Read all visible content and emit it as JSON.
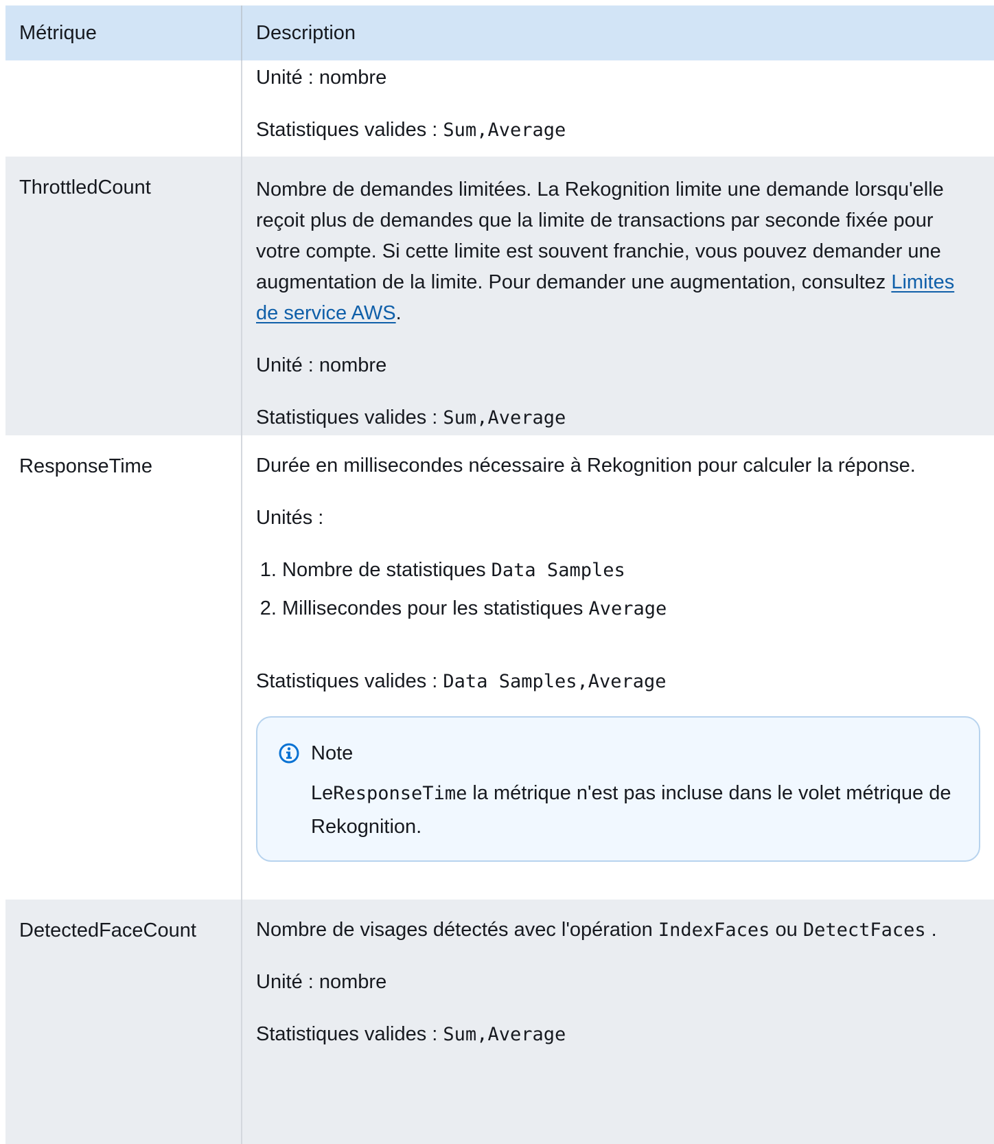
{
  "header": {
    "metric_col": "Métrique",
    "desc_col": "Description"
  },
  "rows": [
    {
      "metric": "",
      "unit": "Unité : nombre",
      "stats_label": "Statistiques valides : ",
      "stats_code": "Sum,Average"
    },
    {
      "metric": "ThrottledCount",
      "desc_text": "Nombre de demandes limitées. La Rekognition limite une demande lorsqu'elle reçoit plus de demandes que la limite de transactions par seconde fixée pour votre compte. Si cette limite est souvent franchie, vous pouvez demander une augmentation de la limite. Pour demander une augmentation, consultez ",
      "link_text": "Limites de service AWS",
      "after_link": ".",
      "unit": "Unité : nombre",
      "stats_label": "Statistiques valides : ",
      "stats_code": "Sum,Average"
    },
    {
      "metric": "ResponseTime",
      "desc_text": "Durée en millisecondes nécessaire à Rekognition pour calculer la réponse.",
      "units_label": "Unités :",
      "list": [
        {
          "text": "Nombre de statistiques ",
          "code": "Data Samples"
        },
        {
          "text": "Millisecondes pour les statistiques ",
          "code": "Average"
        }
      ],
      "stats_label": "Statistiques valides : ",
      "stats_code": "Data Samples,Average",
      "note": {
        "title": "Note",
        "prefix": "Le",
        "code": "ResponseTime",
        "text": " la métrique n'est pas incluse dans le volet métrique de Rekognition."
      }
    },
    {
      "metric": "DetectedFaceCount",
      "desc_text": "Nombre de visages détectés avec l'opération ",
      "code1": "IndexFaces",
      "mid": " ou ",
      "code2": "DetectFaces",
      "end": " .",
      "unit": "Unité : nombre",
      "stats_label": "Statistiques valides : ",
      "stats_code": "Sum,Average"
    }
  ],
  "colors": {
    "header_bg": "#d2e4f6",
    "grey_row_bg": "#eaedf1",
    "link": "#0f5fa9",
    "note_bg": "#f1f8ff",
    "note_border": "#b7d3ee",
    "info_icon": "#0972d3"
  },
  "icons": {
    "note_icon": "info-circle-icon"
  }
}
